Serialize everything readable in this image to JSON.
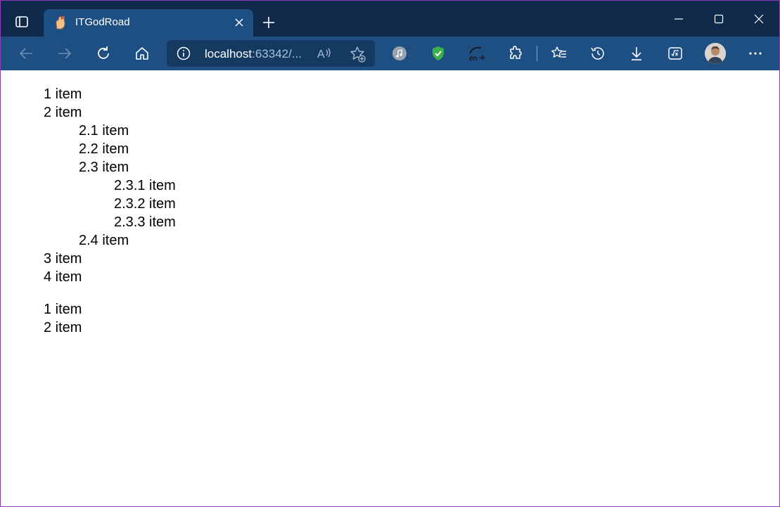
{
  "browser": {
    "tab": {
      "title": "ITGodRoad"
    },
    "address": {
      "host": "localhost",
      "rest": ":63342/..."
    }
  },
  "colors": {
    "titlebar": "#0f2a4a",
    "toolbar": "#1d4f82",
    "addressbar": "#153a61",
    "window_border": "#8b3fb3"
  },
  "icons": {
    "tab_actions": "tab-actions-icon",
    "favicon": "hand-favicon-icon",
    "close_tab": "close-icon",
    "new_tab": "plus-icon",
    "back": "arrow-left-icon",
    "forward": "arrow-right-icon",
    "refresh": "refresh-icon",
    "home": "home-icon",
    "site_info": "info-icon",
    "read_aloud": "read-aloud-icon",
    "add_favorite": "star-add-icon",
    "ext_music": "music-extension-icon",
    "ext_shield": "shield-extension-icon",
    "ext_translate": "translate-extension-icon",
    "extensions": "puzzle-icon",
    "favorites": "favorites-icon",
    "history": "history-icon",
    "downloads": "download-icon",
    "math_solver": "math-solver-icon",
    "profile": "avatar",
    "more": "more-icon"
  },
  "content": {
    "list_a": [
      {
        "text": "1 item",
        "level": 1
      },
      {
        "text": "2 item",
        "level": 1
      },
      {
        "text": "2.1 item",
        "level": 2
      },
      {
        "text": "2.2 item",
        "level": 2
      },
      {
        "text": "2.3 item",
        "level": 2
      },
      {
        "text": "2.3.1 item",
        "level": 3
      },
      {
        "text": "2.3.2 item",
        "level": 3
      },
      {
        "text": "2.3.3 item",
        "level": 3
      },
      {
        "text": "2.4 item",
        "level": 2
      },
      {
        "text": "3 item",
        "level": 1
      },
      {
        "text": "4 item",
        "level": 1
      }
    ],
    "list_b": [
      {
        "text": "1 item",
        "level": 1
      },
      {
        "text": "2 item",
        "level": 1
      }
    ]
  }
}
